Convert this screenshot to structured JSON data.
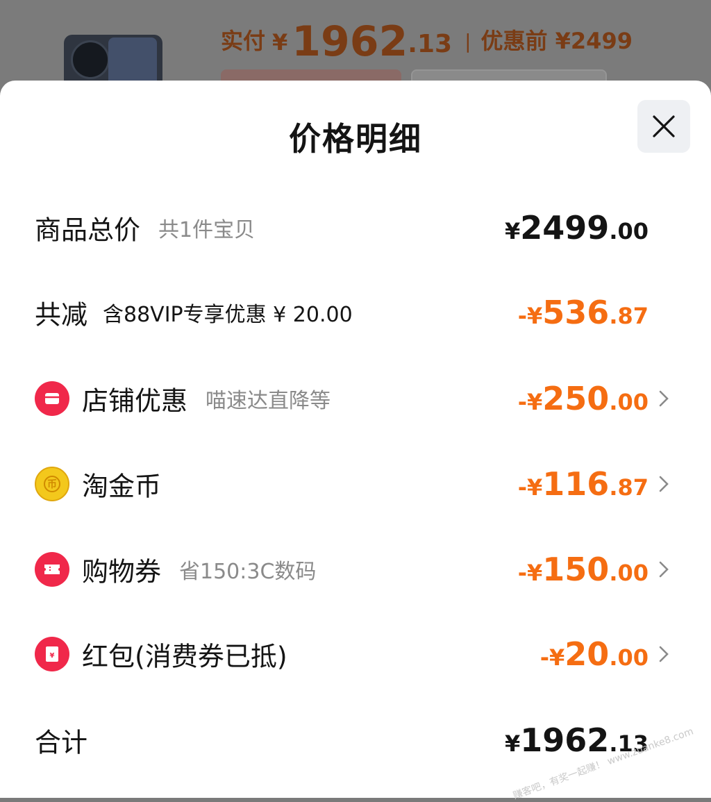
{
  "background": {
    "paid_label": "实付",
    "paid_yen": "¥",
    "paid_int": "1962",
    "paid_dec": ".13",
    "separator": "|",
    "original_price": "优惠前 ¥2499"
  },
  "sheet": {
    "title": "价格明细",
    "close_icon": "close-icon"
  },
  "rows": {
    "subtotal": {
      "label": "商品总价",
      "note": "共1件宝贝",
      "prefix": "¥",
      "int": "2499",
      "dec": ".00"
    },
    "discount": {
      "label": "共减",
      "note": "含88VIP专享优惠 ¥ 20.00",
      "prefix": "-¥",
      "int": "536",
      "dec": ".87"
    },
    "shop": {
      "label": "店铺优惠",
      "note": "喵速达直降等",
      "prefix": "-¥",
      "int": "250",
      "dec": ".00",
      "icon": "shop-icon"
    },
    "coins": {
      "label": "淘金币",
      "note": "",
      "prefix": "-¥",
      "int": "116",
      "dec": ".87",
      "icon": "coin-icon"
    },
    "coupon": {
      "label": "购物券",
      "note": "省150:3C数码",
      "prefix": "-¥",
      "int": "150",
      "dec": ".00",
      "icon": "coupon-icon"
    },
    "redpacket": {
      "label": "红包(消费券已抵)",
      "note": "",
      "prefix": "-¥",
      "int": "20",
      "dec": ".00",
      "icon": "red-packet-icon"
    },
    "total": {
      "label": "合计",
      "prefix": "¥",
      "int": "1962",
      "dec": ".13"
    }
  },
  "watermark": "赚客吧，有奖一起赚！ www.zuanke8.com",
  "colors": {
    "accent": "#f56d12",
    "icon_red": "#f0284a",
    "coin_gold": "#f3c81c",
    "text": "#141414",
    "muted": "#8a8a8a"
  }
}
